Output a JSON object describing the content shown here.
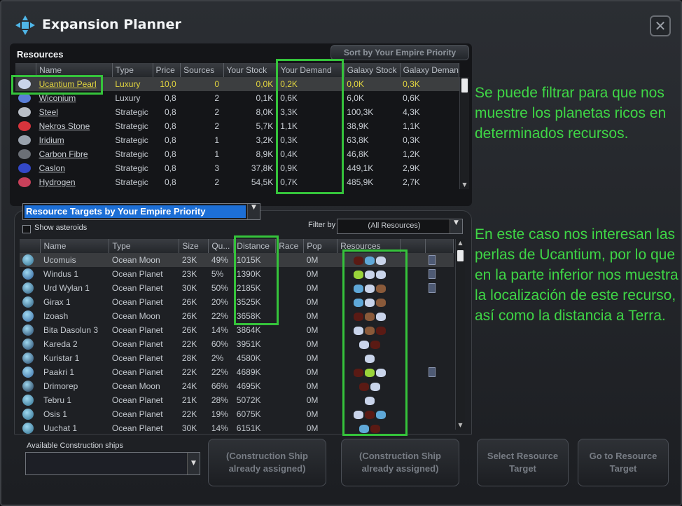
{
  "window": {
    "title": "Expansion Planner",
    "close_symbol": "✕"
  },
  "resources": {
    "heading": "Resources",
    "sort_button": "Sort by Your Empire Priority",
    "columns": [
      "Name",
      "Type",
      "Price",
      "Sources",
      "Your Stock",
      "Your Demand",
      "Galaxy Stock",
      "Galaxy Deman"
    ],
    "rows": [
      {
        "name": "Ucantium Pearl",
        "type": "Luxury",
        "price": "10,0",
        "sources": "0",
        "stock": "0,0K",
        "demand": "0,2K",
        "galaxy_stock": "0,0K",
        "galaxy_demand": "0,3K",
        "icon_color": "#c9d4ea",
        "selected": true
      },
      {
        "name": "Wiconium",
        "type": "Luxury",
        "price": "0,8",
        "sources": "2",
        "stock": "0,1K",
        "demand": "0,6K",
        "galaxy_stock": "6,0K",
        "galaxy_demand": "0,6K",
        "icon_color": "#5a7fd8"
      },
      {
        "name": "Steel",
        "type": "Strategic",
        "price": "0,8",
        "sources": "2",
        "stock": "8,0K",
        "demand": "3,3K",
        "galaxy_stock": "100,3K",
        "galaxy_demand": "4,3K",
        "icon_color": "#b9bec6"
      },
      {
        "name": "Nekros Stone",
        "type": "Strategic",
        "price": "0,8",
        "sources": "2",
        "stock": "5,7K",
        "demand": "1,1K",
        "galaxy_stock": "38,9K",
        "galaxy_demand": "1,1K",
        "icon_color": "#d6343c"
      },
      {
        "name": "Iridium",
        "type": "Strategic",
        "price": "0,8",
        "sources": "1",
        "stock": "3,2K",
        "demand": "0,3K",
        "galaxy_stock": "63,8K",
        "galaxy_demand": "0,3K",
        "icon_color": "#9aa2ad"
      },
      {
        "name": "Carbon Fibre",
        "type": "Strategic",
        "price": "0,8",
        "sources": "1",
        "stock": "8,9K",
        "demand": "0,4K",
        "galaxy_stock": "46,8K",
        "galaxy_demand": "1,2K",
        "icon_color": "#6b6f76"
      },
      {
        "name": "Caslon",
        "type": "Strategic",
        "price": "0,8",
        "sources": "3",
        "stock": "37,8K",
        "demand": "0,9K",
        "galaxy_stock": "449,1K",
        "galaxy_demand": "2,9K",
        "icon_color": "#3348c8"
      },
      {
        "name": "Hydrogen",
        "type": "Strategic",
        "price": "0,8",
        "sources": "2",
        "stock": "54,5K",
        "demand": "0,7K",
        "galaxy_stock": "485,9K",
        "galaxy_demand": "2,7K",
        "icon_color": "#c8405a"
      }
    ]
  },
  "targets": {
    "priority_select": "Resource Targets by Your Empire Priority",
    "show_asteroids": "Show asteroids",
    "filter_label": "Filter by",
    "filter_value": "(All Resources)",
    "columns": [
      "Name",
      "Type",
      "Size",
      "Qu...",
      "Distance",
      "Race",
      "Pop",
      "Resources"
    ],
    "rows": [
      {
        "name": "Ucomuis",
        "type": "Ocean Moon",
        "size": "23K",
        "quality": "49%",
        "distance": "1015K",
        "race": "",
        "pop": "0M",
        "planet_color": "#2f6f8f",
        "res": [
          "#5a1a14",
          "#5fa8d8",
          "#c9d4ea"
        ],
        "flag": true,
        "selected": true
      },
      {
        "name": "Windus 1",
        "type": "Ocean Planet",
        "size": "23K",
        "quality": "5%",
        "distance": "1390K",
        "race": "",
        "pop": "0M",
        "planet_color": "#2e5f9a",
        "res": [
          "#9ad43a",
          "#c9d4ea",
          "#c9d4ea"
        ],
        "flag": true
      },
      {
        "name": "Urd Wylan 1",
        "type": "Ocean Planet",
        "size": "30K",
        "quality": "50%",
        "distance": "2185K",
        "race": "",
        "pop": "0M",
        "planet_color": "#2a5a7c",
        "res": [
          "#5fa8d8",
          "#c9d4ea",
          "#8a5a3a"
        ],
        "flag": true
      },
      {
        "name": "Girax 1",
        "type": "Ocean Planet",
        "size": "26K",
        "quality": "20%",
        "distance": "3525K",
        "race": "",
        "pop": "0M",
        "planet_color": "#2a5a7c",
        "res": [
          "#5fa8d8",
          "#c9d4ea",
          "#8a5a3a"
        ]
      },
      {
        "name": "Izoash",
        "type": "Ocean Moon",
        "size": "26K",
        "quality": "22%",
        "distance": "3658K",
        "race": "",
        "pop": "0M",
        "planet_color": "#3a6fa8",
        "res": [
          "#5a1a14",
          "#8a5a3a",
          "#c9d4ea"
        ]
      },
      {
        "name": "Bita Dasolun 3",
        "type": "Ocean Planet",
        "size": "26K",
        "quality": "14%",
        "distance": "3864K",
        "race": "",
        "pop": "0M",
        "planet_color": "#24466a",
        "res": [
          "#c9d4ea",
          "#8a5a3a",
          "#5a1a14"
        ]
      },
      {
        "name": "Kareda 2",
        "type": "Ocean Planet",
        "size": "22K",
        "quality": "60%",
        "distance": "3951K",
        "race": "",
        "pop": "0M",
        "planet_color": "#24466a",
        "res": [
          "#c9d4ea",
          "#5a1a14"
        ]
      },
      {
        "name": "Kuristar 1",
        "type": "Ocean Planet",
        "size": "28K",
        "quality": "2%",
        "distance": "4580K",
        "race": "",
        "pop": "0M",
        "planet_color": "#24466a",
        "res": [
          "#c9d4ea"
        ]
      },
      {
        "name": "Paakri 1",
        "type": "Ocean Planet",
        "size": "22K",
        "quality": "22%",
        "distance": "4689K",
        "race": "",
        "pop": "0M",
        "planet_color": "#3a6fa8",
        "res": [
          "#5a1a14",
          "#9ad43a",
          "#c9d4ea"
        ],
        "flag": true
      },
      {
        "name": "Drimorep",
        "type": "Ocean Moon",
        "size": "24K",
        "quality": "66%",
        "distance": "4695K",
        "race": "",
        "pop": "0M",
        "planet_color": "#1c3450",
        "res": [
          "#5a1a14",
          "#c9d4ea"
        ]
      },
      {
        "name": "Tebru 1",
        "type": "Ocean Planet",
        "size": "21K",
        "quality": "28%",
        "distance": "5072K",
        "race": "",
        "pop": "0M",
        "planet_color": "#2f6f8f",
        "res": [
          "#c9d4ea"
        ]
      },
      {
        "name": "Osis 1",
        "type": "Ocean Planet",
        "size": "22K",
        "quality": "19%",
        "distance": "6075K",
        "race": "",
        "pop": "0M",
        "planet_color": "#2f6f8f",
        "res": [
          "#c9d4ea",
          "#5a1a14",
          "#5fa8d8"
        ]
      },
      {
        "name": "Uuchat 1",
        "type": "Ocean Planet",
        "size": "30K",
        "quality": "14%",
        "distance": "6151K",
        "race": "",
        "pop": "0M",
        "planet_color": "#2f6f8f",
        "res": [
          "#5fa8d8",
          "#5a1a14"
        ]
      }
    ]
  },
  "construction": {
    "label": "Available Construction ships",
    "btn1": "(Construction Ship already assigned)",
    "btn2": "(Construction Ship already assigned)",
    "btn3": "Select Resource Target",
    "btn4": "Go to Resource Target"
  },
  "annotations": {
    "note1": "Se puede filtrar para que nos muestre los planetas ricos en determinados recursos.",
    "note2": "En este caso nos interesan las perlas de Ucantium, por lo que en la parte inferior nos muestra la localización de este recurso, así como la distancia a Terra."
  },
  "colors": {
    "highlight": "#35c33b",
    "accent_blue": "#1d6fd6",
    "selected_text": "#e2d53f"
  }
}
